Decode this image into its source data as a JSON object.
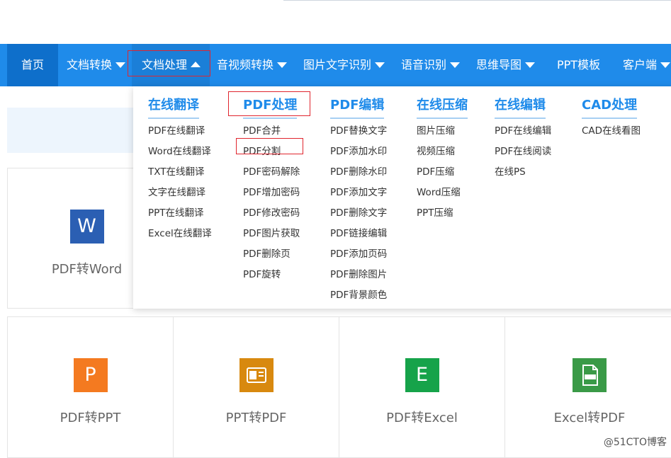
{
  "nav": {
    "items": [
      {
        "label": "首页",
        "caret": false
      },
      {
        "label": "文档转换",
        "caret": "down"
      },
      {
        "label": "文档处理",
        "caret": "up"
      },
      {
        "label": "音视频转换",
        "caret": "down"
      },
      {
        "label": "图片文字识别",
        "caret": "down"
      },
      {
        "label": "语音识别",
        "caret": "down"
      },
      {
        "label": "思维导图",
        "caret": "down"
      },
      {
        "label": "PPT模板",
        "caret": false
      },
      {
        "label": "客户端",
        "caret": "down"
      }
    ]
  },
  "cards": [
    {
      "label": "PDF转Word",
      "icon": "W",
      "color": "#2b5fb3"
    },
    {
      "label": "PDF转PPT",
      "icon": "P",
      "color": "#f47a20"
    },
    {
      "label": "PPT转PDF",
      "icon": "ppt-pdf-icon",
      "color": "#d8890f"
    },
    {
      "label": "PDF转Excel",
      "icon": "E",
      "color": "#16a34a"
    },
    {
      "label": "Excel转PDF",
      "icon": "pdf-doc-icon",
      "color": "#3a9a47"
    }
  ],
  "dropdown": {
    "columns": [
      {
        "title": "在线翻译",
        "links": [
          "PDF在线翻译",
          "Word在线翻译",
          "TXT在线翻译",
          "文字在线翻译",
          "PPT在线翻译",
          "Excel在线翻译"
        ]
      },
      {
        "title": "PDF处理",
        "links": [
          "PDF合并",
          "PDF分割",
          "PDF密码解除",
          "PDF增加密码",
          "PDF修改密码",
          "PDF图片获取",
          "PDF删除页",
          "PDF旋转"
        ]
      },
      {
        "title": "PDF编辑",
        "links": [
          "PDF替换文字",
          "PDF添加水印",
          "PDF删除水印",
          "PDF添加文字",
          "PDF删除文字",
          "PDF链接编辑",
          "PDF添加页码",
          "PDF删除图片",
          "PDF背景颜色"
        ]
      },
      {
        "title": "在线压缩",
        "links": [
          "图片压缩",
          "视频压缩",
          "PDF压缩",
          "Word压缩",
          "PPT压缩"
        ]
      },
      {
        "title": "在线编辑",
        "links": [
          "PDF在线编辑",
          "PDF在线阅读",
          "在线PS"
        ]
      },
      {
        "title": "CAD处理",
        "links": [
          "CAD在线看图"
        ]
      }
    ]
  },
  "watermark": "@51CTO博客",
  "colors": {
    "nav": "#1f8bea",
    "nav_home": "#0e6fcb",
    "accent": "#1f8bea",
    "highlight_box": "#e0252e"
  }
}
